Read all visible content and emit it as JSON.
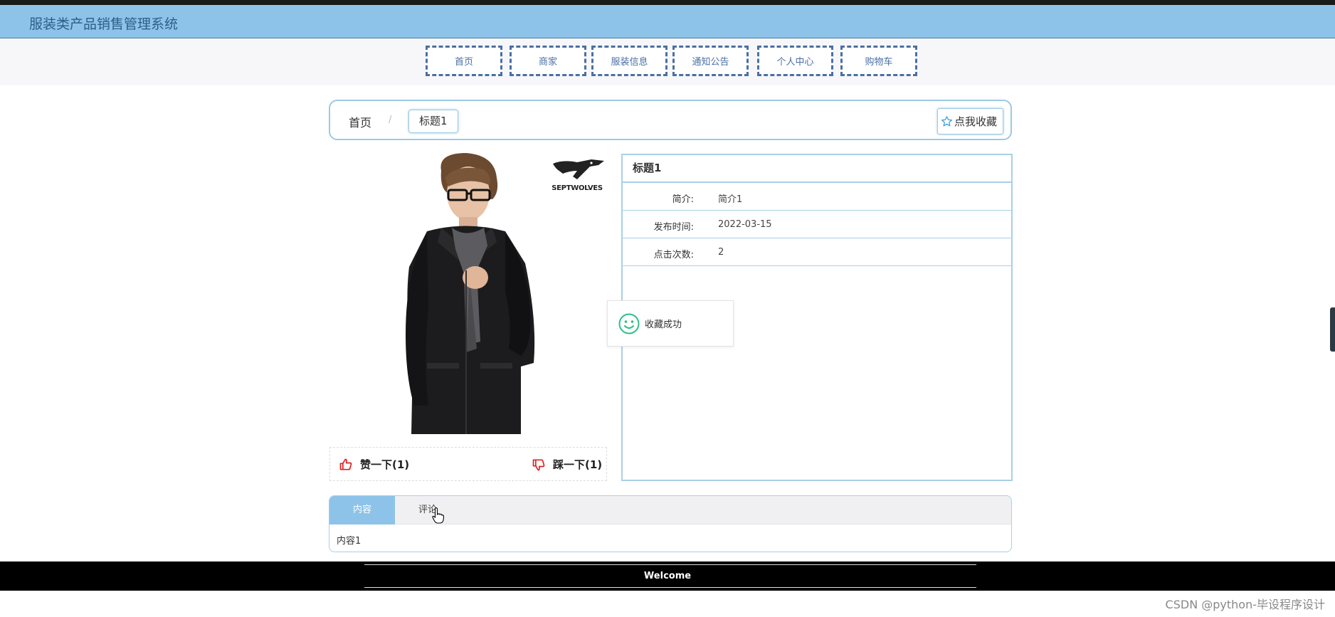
{
  "app": {
    "title": "服装类产品销售管理系统"
  },
  "nav": {
    "items": [
      {
        "label": "首页"
      },
      {
        "label": "商家"
      },
      {
        "label": "服装信息"
      },
      {
        "label": "通知公告"
      },
      {
        "label": "个人中心"
      },
      {
        "label": "购物车"
      }
    ]
  },
  "breadcrumb": {
    "home": "首页",
    "separator": "/",
    "current": "标题1"
  },
  "favorite": {
    "label": "点我收藏",
    "icon": "star-outline-icon"
  },
  "product": {
    "image": "man-in-black-jacket-with-scarf",
    "brand_logo_text": "SEPTWOLVES"
  },
  "votes": {
    "like": {
      "label": "赞一下(1)",
      "icon": "thumbs-up-icon"
    },
    "dislike": {
      "label": "踩一下(1)",
      "icon": "thumbs-down-icon"
    }
  },
  "info": {
    "title": "标题1",
    "rows": [
      {
        "label": "简介:",
        "value": "简介1"
      },
      {
        "label": "发布时间:",
        "value": "2022-03-15"
      },
      {
        "label": "点击次数:",
        "value": "2"
      }
    ]
  },
  "toast": {
    "text": "收藏成功",
    "icon": "smile-icon"
  },
  "tabs": {
    "items": [
      {
        "label": "内容"
      },
      {
        "label": "评论"
      }
    ],
    "content": "内容1"
  },
  "footer": {
    "text": "Welcome"
  },
  "watermark": {
    "text": "CSDN @python-毕设程序设计"
  },
  "colors": {
    "accent": "#8dc3e8",
    "nav_border": "#4a6fa5",
    "vote_icon": "#e02020",
    "toast_icon": "#2bbf8a"
  }
}
